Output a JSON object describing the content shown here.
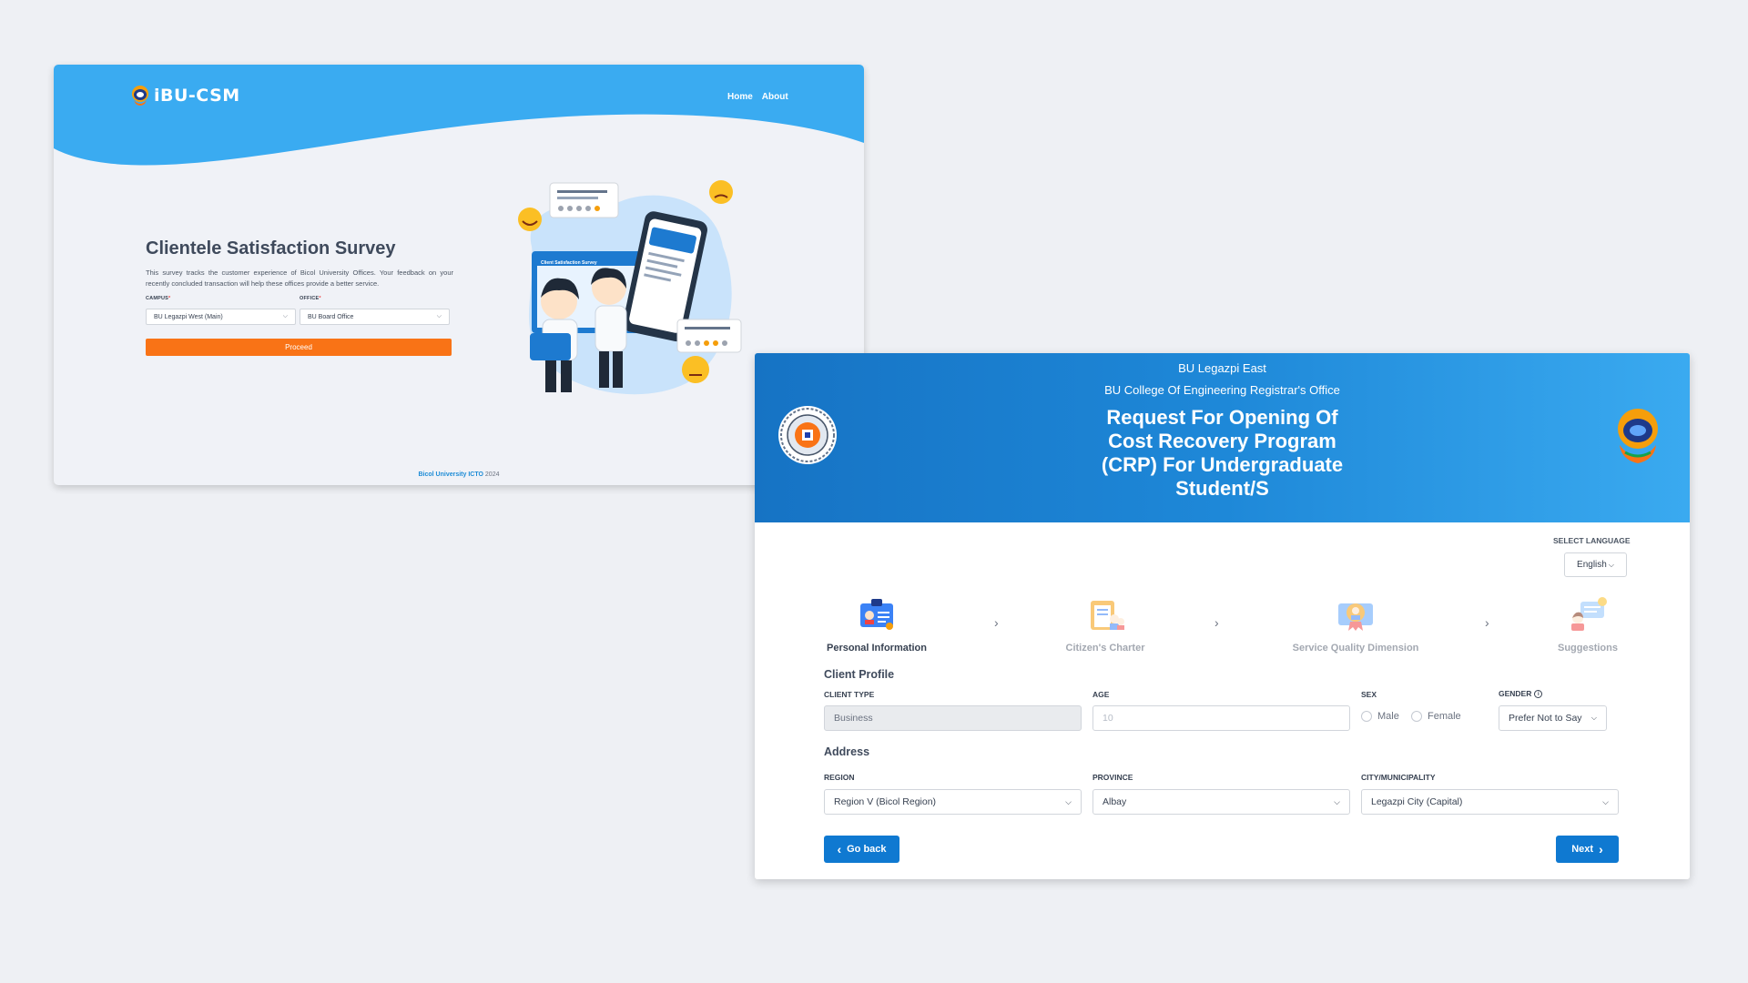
{
  "left_window": {
    "logo_text": "iBU-CSM",
    "nav": [
      "Home",
      "About"
    ],
    "title": "Clientele Satisfaction Survey",
    "description": "This survey tracks the customer experience of Bicol University Offices. Your feedback on your recently concluded transaction will help these offices provide a better service.",
    "campus_label": "CAMPUS",
    "campus_value": "BU Legazpi West (Main)",
    "office_label": "OFFICE",
    "office_value": "BU Board Office",
    "required_mark": "*",
    "proceed_label": "Proceed",
    "illustration_screen_text": "Client Satisfaction Survey",
    "footer_org": "Bicol University ICTO",
    "footer_year": "2024"
  },
  "right_window": {
    "campus": "BU Legazpi East",
    "office": "BU College Of Engineering Registrar's Office",
    "service_title": "Request For Opening Of Cost Recovery Program (CRP) For Undergraduate Student/S",
    "language_label": "SELECT LANGUAGE",
    "language_value": "English",
    "steps": [
      {
        "label": "Personal Information",
        "icon": "id-card-icon",
        "active": true
      },
      {
        "label": "Citizen's Charter",
        "icon": "clipboard-people-icon",
        "active": false
      },
      {
        "label": "Service Quality Dimension",
        "icon": "award-badge-icon",
        "active": false
      },
      {
        "label": "Suggestions",
        "icon": "chat-lightbulb-icon",
        "active": false
      }
    ],
    "client_profile_heading": "Client Profile",
    "client_type_label": "CLIENT TYPE",
    "client_type_value": "Business",
    "age_label": "AGE",
    "age_placeholder": "10",
    "sex_label": "SEX",
    "sex_options": [
      "Male",
      "Female"
    ],
    "gender_label": "GENDER",
    "gender_value": "Prefer Not to Say",
    "address_heading": "Address",
    "region_label": "REGION",
    "region_value": "Region V (Bicol Region)",
    "province_label": "PROVINCE",
    "province_value": "Albay",
    "city_label": "CITY/MUNICIPALITY",
    "city_value": "Legazpi City (Capital)",
    "go_back_label": "Go back",
    "next_label": "Next"
  },
  "colors": {
    "header_blue": "#3aabf1",
    "accent_orange": "#f97316",
    "button_blue": "#0f79d1",
    "page_bg": "#eef0f4"
  }
}
